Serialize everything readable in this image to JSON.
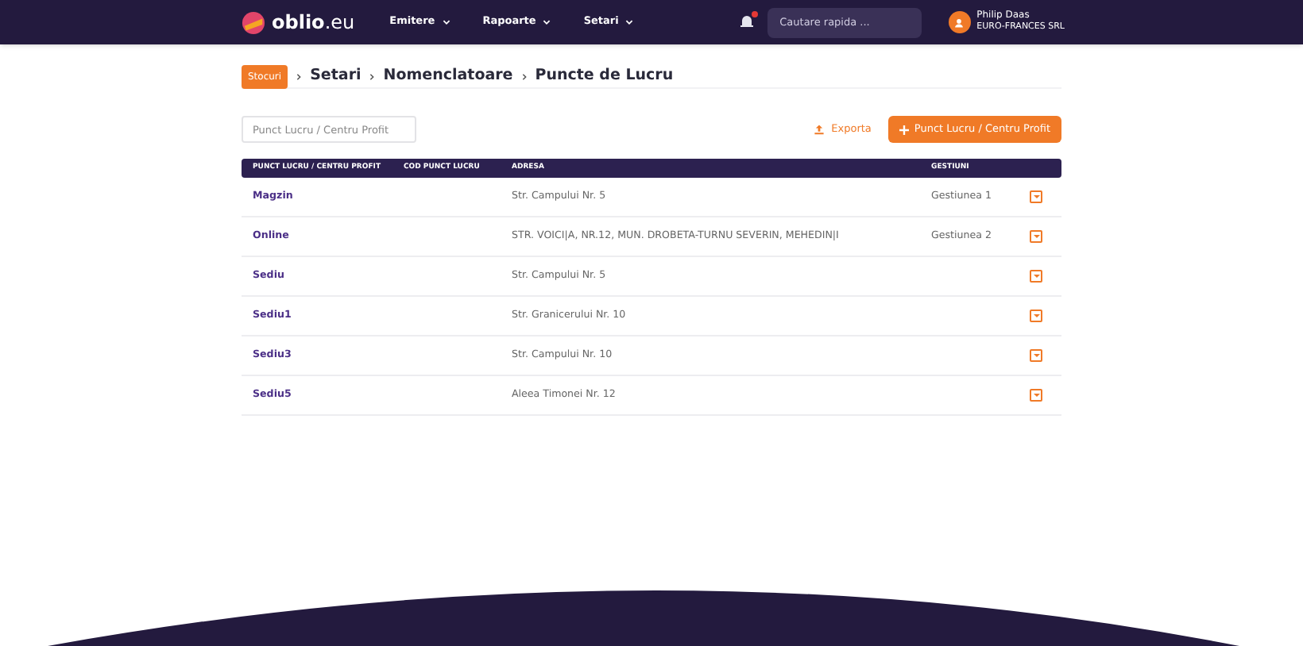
{
  "nav": {
    "logo": "oblio",
    "logo_suffix": ".eu",
    "menus": [
      {
        "label": "Emitere"
      },
      {
        "label": "Rapoarte"
      },
      {
        "label": "Setari"
      }
    ],
    "search": {
      "placeholder": "Cautare rapida ..."
    },
    "user": {
      "name": "Philip Daas",
      "company": "EURO-FRANCES SRL"
    }
  },
  "breadcrumb": {
    "badge": "Stocuri",
    "items": [
      "Setari",
      "Nomenclatoare",
      "Puncte de Lucru"
    ]
  },
  "toolbar": {
    "filter": {
      "placeholder": "Punct Lucru / Centru Profit"
    },
    "export": "Exporta",
    "add": "Punct Lucru / Centru Profit"
  },
  "table": {
    "columns": [
      "PUNCT LUCRU / CENTRU PROFIT",
      "COD PUNCT LUCRU",
      "ADRESA",
      "GESTIUNI"
    ],
    "rows": [
      {
        "name": "Magzin",
        "code": "",
        "address": "Str. Campului Nr. 5",
        "gestiune": "Gestiunea 1"
      },
      {
        "name": "Online",
        "code": "",
        "address": "STR. VOICI|A, NR.12, MUN. DROBETA-TURNU SEVERIN, MEHEDIN|I",
        "gestiune": "Gestiunea 2"
      },
      {
        "name": "Sediu",
        "code": "",
        "address": "Str. Campului Nr. 5",
        "gestiune": ""
      },
      {
        "name": "Sediu1",
        "code": "",
        "address": "Str. Granicerului Nr. 10",
        "gestiune": ""
      },
      {
        "name": "Sediu3",
        "code": "",
        "address": "Str. Campului Nr. 10",
        "gestiune": ""
      },
      {
        "name": "Sediu5",
        "code": "",
        "address": "Aleea Timonei Nr. 12",
        "gestiune": ""
      }
    ]
  }
}
